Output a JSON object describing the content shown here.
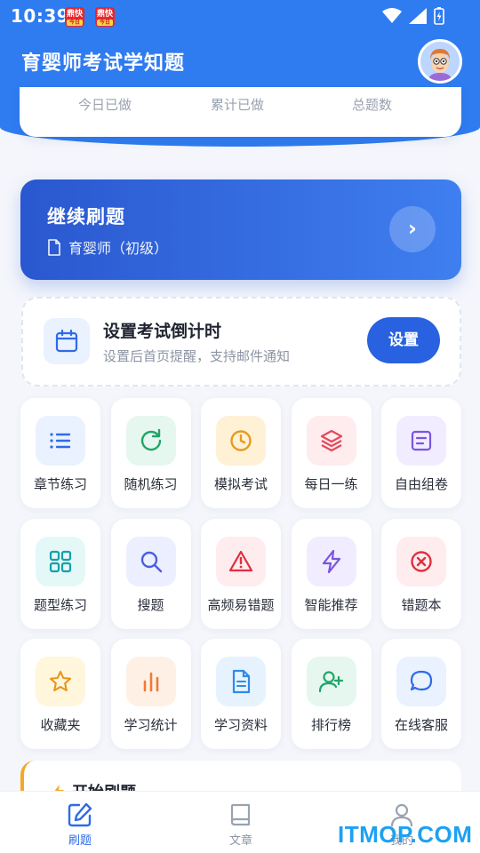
{
  "status_bar": {
    "time": "10:39",
    "notif_text": "鼎快",
    "notif_sub": "今日"
  },
  "header": {
    "title": "育婴师考试学知题"
  },
  "stats": {
    "today_done": "今日已做",
    "total_done": "累计已做",
    "total_questions": "总题数"
  },
  "continue_card": {
    "title": "继续刷题",
    "subtitle": "育婴师（初级）",
    "arrow": "›"
  },
  "countdown": {
    "title": "设置考试倒计时",
    "subtitle": "设置后首页提醒，支持邮件通知",
    "button": "设置"
  },
  "grid": [
    {
      "label": "章节练习",
      "icon": "list-icon",
      "bg": "#eaf1ff",
      "color": "#2f6be6"
    },
    {
      "label": "随机练习",
      "icon": "refresh-icon",
      "bg": "#e6f7ef",
      "color": "#22a56a"
    },
    {
      "label": "模拟考试",
      "icon": "clock-icon",
      "bg": "#fff1d6",
      "color": "#e89a1b"
    },
    {
      "label": "每日一练",
      "icon": "layers-icon",
      "bg": "#ffecee",
      "color": "#e24a5a"
    },
    {
      "label": "自由组卷",
      "icon": "document-icon",
      "bg": "#f1ecff",
      "color": "#7a55e0"
    },
    {
      "label": "题型练习",
      "icon": "grid-icon",
      "bg": "#e4f8f8",
      "color": "#14a0a6"
    },
    {
      "label": "搜题",
      "icon": "search-icon",
      "bg": "#ecefff",
      "color": "#4a5fe0"
    },
    {
      "label": "高频易错题",
      "icon": "warning-icon",
      "bg": "#ffecee",
      "color": "#e02f3e"
    },
    {
      "label": "智能推荐",
      "icon": "lightning-icon",
      "bg": "#f1ecff",
      "color": "#7a55e0"
    },
    {
      "label": "错题本",
      "icon": "x-circle-icon",
      "bg": "#ffecee",
      "color": "#e02f3e"
    },
    {
      "label": "收藏夹",
      "icon": "star-icon",
      "bg": "#fff6dc",
      "color": "#e6961a"
    },
    {
      "label": "学习统计",
      "icon": "bar-chart-icon",
      "bg": "#fff0e6",
      "color": "#ef7a36"
    },
    {
      "label": "学习资料",
      "icon": "file-text-icon",
      "bg": "#e6f3ff",
      "color": "#2f8be6"
    },
    {
      "label": "排行榜",
      "icon": "user-plus-icon",
      "bg": "#e6f7ef",
      "color": "#22a56a"
    },
    {
      "label": "在线客服",
      "icon": "chat-icon",
      "bg": "#eaf1ff",
      "color": "#2f6be6"
    }
  ],
  "start_card": {
    "title": "开始刷题"
  },
  "bottom_nav": [
    {
      "label": "刷题",
      "icon": "edit-icon",
      "active": true
    },
    {
      "label": "文章",
      "icon": "book-icon",
      "active": false
    },
    {
      "label": "我的",
      "icon": "user-icon",
      "active": false
    }
  ],
  "watermark": "ITMOP.COM",
  "colors": {
    "primary": "#2f7bf0",
    "accent": "#2862e0",
    "background": "#f4f6fb"
  }
}
